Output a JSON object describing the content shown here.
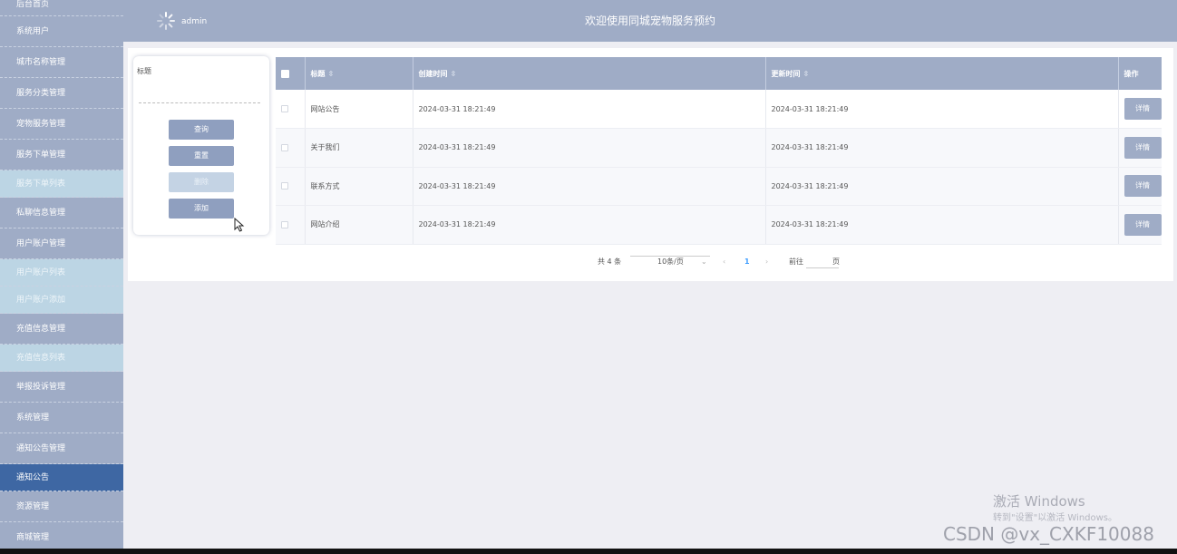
{
  "sidebar": {
    "items": [
      {
        "label": "后台首页"
      },
      {
        "label": "系统用户"
      },
      {
        "label": "城市名称管理"
      },
      {
        "label": "服务分类管理"
      },
      {
        "label": "宠物服务管理"
      },
      {
        "label": "服务下单管理"
      },
      {
        "label": "服务下单列表"
      },
      {
        "label": "私聊信息管理"
      },
      {
        "label": "用户账户管理"
      },
      {
        "label": "用户账户列表"
      },
      {
        "label": "用户账户添加"
      },
      {
        "label": "充值信息管理"
      },
      {
        "label": "充值信息列表"
      },
      {
        "label": "举报投诉管理"
      },
      {
        "label": "系统管理"
      },
      {
        "label": "通知公告管理"
      },
      {
        "label": "通知公告"
      },
      {
        "label": "资源管理"
      },
      {
        "label": "商城管理"
      }
    ]
  },
  "header": {
    "user_name": "admin",
    "title": "欢迎使用同城宠物服务预约"
  },
  "search": {
    "label": "标题",
    "value": "",
    "buttons": {
      "query": "查询",
      "reset": "重置",
      "delete": "删除",
      "add": "添加"
    }
  },
  "table": {
    "headers": {
      "title": "标题",
      "created": "创建时间",
      "updated": "更新时间",
      "action": "操作"
    },
    "rows": [
      {
        "title": "网站公告",
        "created": "2024-03-31 18:21:49",
        "updated": "2024-03-31 18:21:49",
        "action": "详情"
      },
      {
        "title": "关于我们",
        "created": "2024-03-31 18:21:49",
        "updated": "2024-03-31 18:21:49",
        "action": "详情"
      },
      {
        "title": "联系方式",
        "created": "2024-03-31 18:21:49",
        "updated": "2024-03-31 18:21:49",
        "action": "详情"
      },
      {
        "title": "网站介绍",
        "created": "2024-03-31 18:21:49",
        "updated": "2024-03-31 18:21:49",
        "action": "详情"
      }
    ]
  },
  "pagination": {
    "total": "共 4 条",
    "page_size": "10条/页",
    "current_page": "1",
    "goto_prefix": "前往",
    "goto_suffix": "页",
    "goto_value": ""
  },
  "watermark": {
    "activate": "激活 Windows",
    "activate_sub": "转到\"设置\"以激活 Windows。",
    "csdn": "CSDN @vx_CXKF10088"
  },
  "colors": {
    "accent": "#9facc6",
    "active": "#3e67a3",
    "submenu": "#bcd5e4",
    "background": "#eeeef3"
  }
}
